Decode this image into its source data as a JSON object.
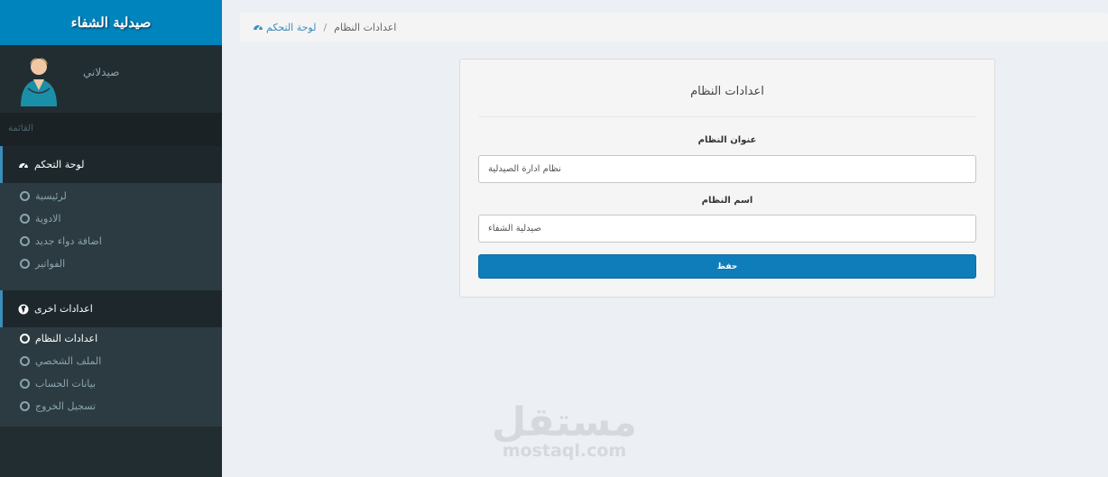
{
  "brand": {
    "title": "صيدلية الشفاء"
  },
  "user": {
    "name": "صيدلاني"
  },
  "menu": {
    "header": "القائمة",
    "sections": [
      {
        "label": "لوحة التحكم",
        "icon": "dashboard-icon",
        "items": [
          "لرئيسية",
          "الادوية",
          "اضافة دواء جديد",
          "الفواتير"
        ]
      },
      {
        "label": "اعدادات اخرى",
        "icon": "globe-icon",
        "items": [
          "اعدادات النظام",
          "الملف الشخصي",
          "بيانات الحساب",
          "تسجيل الخروج"
        ],
        "active_index": 0
      }
    ]
  },
  "breadcrumb": {
    "home": "لوحة التحكم",
    "separator": "/",
    "current": "اعدادات النظام"
  },
  "settings": {
    "title": "اعدادات النظام",
    "address_label": "عنوان النظام",
    "address_value": "نظام ادارة الصيدلية",
    "name_label": "اسم النظام",
    "name_value": "صيدلية الشفاء",
    "save_label": "حفظ"
  },
  "watermark": {
    "arabic": "مستقل",
    "latin": "mostaql.com"
  },
  "colors": {
    "brand": "#0084bd",
    "sidebar": "#222d32",
    "button": "#0e7dba"
  }
}
